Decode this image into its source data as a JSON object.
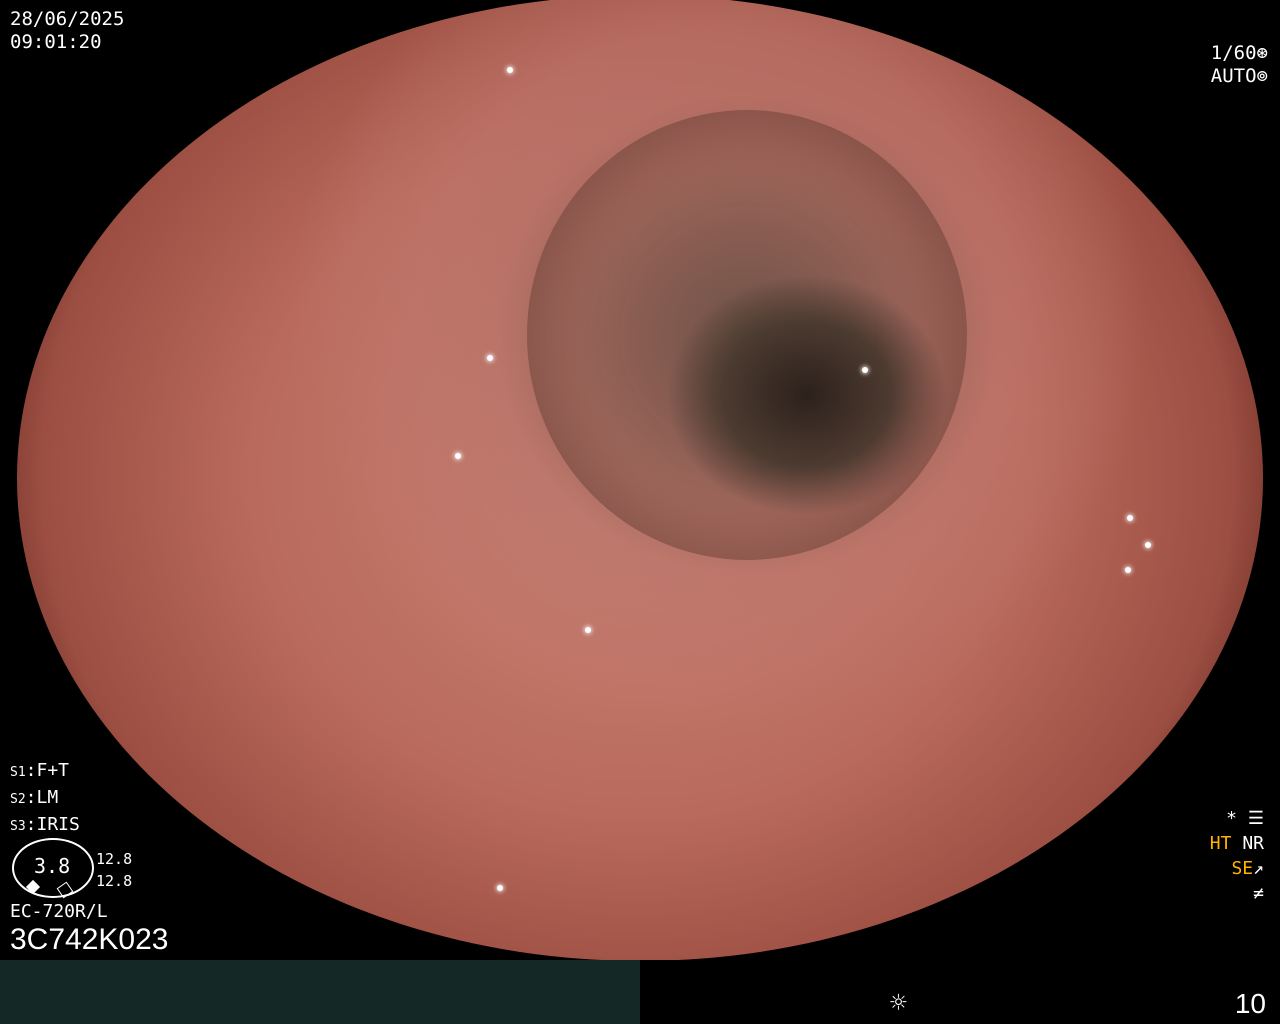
{
  "datetime": {
    "date": "28/06/2025",
    "time": "09:01:20"
  },
  "shutter": {
    "speed": "1/60",
    "mode": "AUTO",
    "speed_icon": "aperture-icon",
    "mode_icon": "iris-icon"
  },
  "settings": {
    "s1_label": "S1",
    "s1_value": "F+T",
    "s2_label": "S2",
    "s2_value": "LM",
    "s3_label": "S3",
    "s3_value": "IRIS"
  },
  "scale": {
    "center": "3.8",
    "top": "12.8",
    "bottom": "12.8"
  },
  "scope": {
    "model": "EC-720R/L",
    "serial": "3C742K023"
  },
  "enhancements": {
    "star": "*",
    "ht": "HT",
    "nr": "NR",
    "se": "SE",
    "ht_color": "#ffb300",
    "se_color": "#ffb300"
  },
  "bottom": {
    "brightness_icon": "sun-icon",
    "level": "10"
  }
}
